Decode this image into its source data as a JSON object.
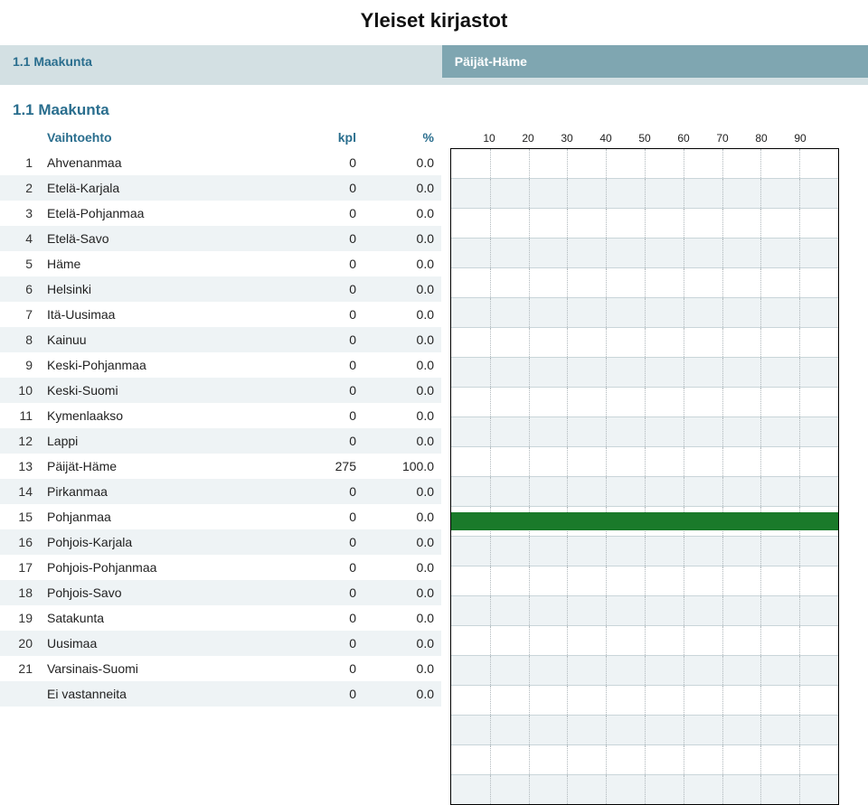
{
  "title": "Yleiset kirjastot",
  "header": {
    "label": "1.1 Maakunta",
    "value": "Päijät-Häme"
  },
  "section_title": "1.1 Maakunta",
  "columns": {
    "opt": "Vaihtoehto",
    "kpl": "kpl",
    "pct": "%"
  },
  "axis_ticks": [
    10,
    20,
    30,
    40,
    50,
    60,
    70,
    80,
    90
  ],
  "rows": [
    {
      "n": "1",
      "name": "Ahvenanmaa",
      "kpl": "0",
      "pct": "0.0"
    },
    {
      "n": "2",
      "name": "Etelä-Karjala",
      "kpl": "0",
      "pct": "0.0"
    },
    {
      "n": "3",
      "name": "Etelä-Pohjanmaa",
      "kpl": "0",
      "pct": "0.0"
    },
    {
      "n": "4",
      "name": "Etelä-Savo",
      "kpl": "0",
      "pct": "0.0"
    },
    {
      "n": "5",
      "name": "Häme",
      "kpl": "0",
      "pct": "0.0"
    },
    {
      "n": "6",
      "name": "Helsinki",
      "kpl": "0",
      "pct": "0.0"
    },
    {
      "n": "7",
      "name": "Itä-Uusimaa",
      "kpl": "0",
      "pct": "0.0"
    },
    {
      "n": "8",
      "name": "Kainuu",
      "kpl": "0",
      "pct": "0.0"
    },
    {
      "n": "9",
      "name": "Keski-Pohjanmaa",
      "kpl": "0",
      "pct": "0.0"
    },
    {
      "n": "10",
      "name": "Keski-Suomi",
      "kpl": "0",
      "pct": "0.0"
    },
    {
      "n": "11",
      "name": "Kymenlaakso",
      "kpl": "0",
      "pct": "0.0"
    },
    {
      "n": "12",
      "name": "Lappi",
      "kpl": "0",
      "pct": "0.0"
    },
    {
      "n": "13",
      "name": "Päijät-Häme",
      "kpl": "275",
      "pct": "100.0"
    },
    {
      "n": "14",
      "name": "Pirkanmaa",
      "kpl": "0",
      "pct": "0.0"
    },
    {
      "n": "15",
      "name": "Pohjanmaa",
      "kpl": "0",
      "pct": "0.0"
    },
    {
      "n": "16",
      "name": "Pohjois-Karjala",
      "kpl": "0",
      "pct": "0.0"
    },
    {
      "n": "17",
      "name": "Pohjois-Pohjanmaa",
      "kpl": "0",
      "pct": "0.0"
    },
    {
      "n": "18",
      "name": "Pohjois-Savo",
      "kpl": "0",
      "pct": "0.0"
    },
    {
      "n": "19",
      "name": "Satakunta",
      "kpl": "0",
      "pct": "0.0"
    },
    {
      "n": "20",
      "name": "Uusimaa",
      "kpl": "0",
      "pct": "0.0"
    },
    {
      "n": "21",
      "name": "Varsinais-Suomi",
      "kpl": "0",
      "pct": "0.0"
    },
    {
      "n": "",
      "name": "Ei vastanneita",
      "kpl": "0",
      "pct": "0.0"
    }
  ],
  "chart_data": {
    "type": "bar",
    "orientation": "horizontal",
    "xlabel": "%",
    "xlim": [
      0,
      100
    ],
    "categories": [
      "Ahvenanmaa",
      "Etelä-Karjala",
      "Etelä-Pohjanmaa",
      "Etelä-Savo",
      "Häme",
      "Helsinki",
      "Itä-Uusimaa",
      "Kainuu",
      "Keski-Pohjanmaa",
      "Keski-Suomi",
      "Kymenlaakso",
      "Lappi",
      "Päijät-Häme",
      "Pirkanmaa",
      "Pohjanmaa",
      "Pohjois-Karjala",
      "Pohjois-Pohjanmaa",
      "Pohjois-Savo",
      "Satakunta",
      "Uusimaa",
      "Varsinais-Suomi",
      "Ei vastanneita"
    ],
    "values": [
      0,
      0,
      0,
      0,
      0,
      0,
      0,
      0,
      0,
      0,
      0,
      0,
      100,
      0,
      0,
      0,
      0,
      0,
      0,
      0,
      0,
      0
    ],
    "bar_color": "#1a7a2a"
  }
}
